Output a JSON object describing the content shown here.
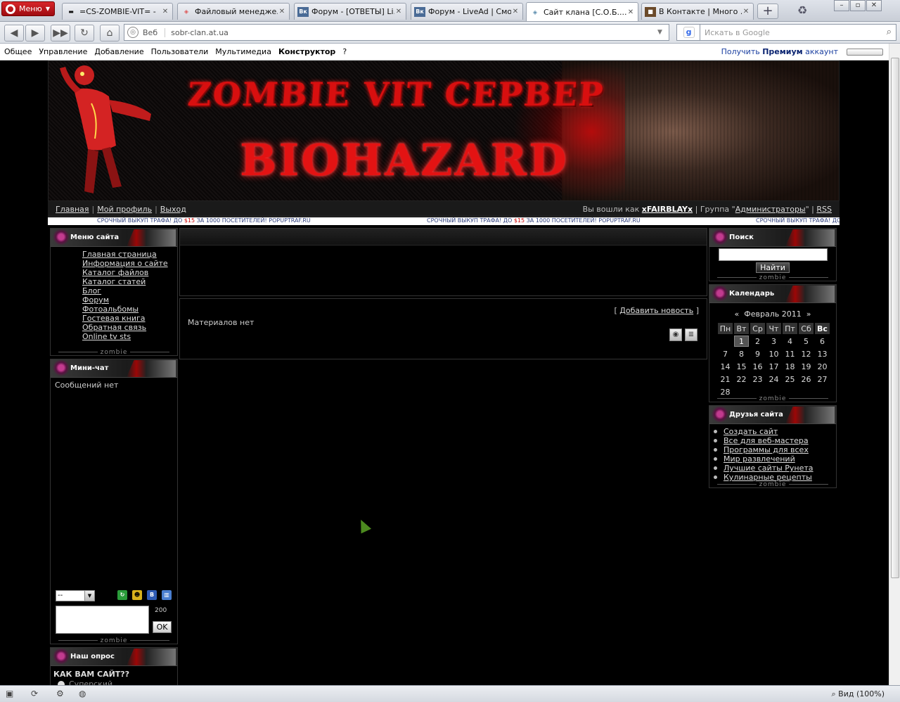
{
  "browser": {
    "menu_label": "Меню",
    "tabs": [
      {
        "title": "=CS-ZOMBIE-VIT= -",
        "icon": "gun-icon"
      },
      {
        "title": "Файловый менедже...",
        "icon": "opera-icon"
      },
      {
        "title": "Форум - [ОТВЕТЫ] Li...",
        "icon": "vk-icon"
      },
      {
        "title": "Форум - LiveAd | Смо...",
        "icon": "vk-icon"
      },
      {
        "title": "Сайт клана [С.О.Б....",
        "icon": "opera-icon",
        "active": true
      },
      {
        "title": "В Контакте | Много ...",
        "icon": "game-icon"
      }
    ],
    "address_label": "Веб",
    "url": "sobr-clan.at.ua",
    "search_placeholder": "Искать в Google",
    "zoom": "Вид (100%)"
  },
  "ucoz_bar": {
    "menu": [
      "Общее",
      "Управление",
      "Добавление",
      "Пользователи",
      "Мультимедиа",
      "Конструктор",
      "?"
    ],
    "premium_pre": "Получить ",
    "premium_bold": "Премиум",
    "premium_post": " аккаунт"
  },
  "banner": {
    "title_top": "ZOMBIE VIT СЕРВЕР",
    "title_bottom": "BIOHAZARD"
  },
  "top_nav": {
    "links": [
      "Главная",
      "Мой профиль",
      "Выход"
    ],
    "logged_in_text": "Вы вошли как",
    "username": "xFAIRBLAYx",
    "group_text": "| Группа \"",
    "group_name": "Администраторы",
    "group_end": "\" |",
    "rss": "RSS"
  },
  "ticker": {
    "pre": "СРОЧНЫЙ ВЫКУП ТРАФА! ДО ",
    "price": "$15",
    "post": " ЗА 1000 ПОСЕТИТЕЛЕЙ!  POPUPTRAF.RU"
  },
  "site_menu": {
    "title": "Меню сайта",
    "items": [
      "Главная страница",
      "Информация о сайте",
      "Каталог файлов",
      "Каталог статей",
      "Блог",
      "Форум",
      "Фотоальбомы",
      "Гостевая книга",
      "Обратная связь",
      "Online tv sts"
    ],
    "footer": "zombie"
  },
  "minichat": {
    "title": "Мини-чат",
    "no_messages": "Сообщений нет",
    "select_value": "--",
    "char_limit": "200",
    "ok": "OK",
    "footer": "zombie"
  },
  "poll": {
    "title": "Наш опрос",
    "question": "КАК ВАМ САЙТ??",
    "option": "Суперский"
  },
  "news": {
    "add_link_open": "[ ",
    "add_link": "Добавить новость",
    "add_link_close": " ]",
    "empty": "Материалов нет"
  },
  "search": {
    "title": "Поиск",
    "button": "Найти",
    "footer": "zombie"
  },
  "calendar": {
    "title": "Календарь",
    "prev": "«",
    "month": "Февраль 2011",
    "next": "»",
    "weekdays": [
      "Пн",
      "Вт",
      "Ср",
      "Чт",
      "Пт",
      "Сб",
      "Вс"
    ],
    "weeks": [
      [
        "",
        "1",
        "2",
        "3",
        "4",
        "5",
        "6"
      ],
      [
        "7",
        "8",
        "9",
        "10",
        "11",
        "12",
        "13"
      ],
      [
        "14",
        "15",
        "16",
        "17",
        "18",
        "19",
        "20"
      ],
      [
        "21",
        "22",
        "23",
        "24",
        "25",
        "26",
        "27"
      ],
      [
        "28",
        "",
        "",
        "",
        "",
        "",
        ""
      ]
    ],
    "today": "1",
    "footer": "zombie"
  },
  "friends": {
    "title": "Друзья сайта",
    "items": [
      "Создать сайт",
      "Все для веб-мастера",
      "Программы для всех",
      "Мир развлечений",
      "Лучшие сайты Рунета",
      "Кулинарные рецепты"
    ],
    "footer": "zombie"
  },
  "colors": {
    "accent_red": "#d80f0f",
    "page_bg": "#000000",
    "ticker_blue": "#2b3c7a"
  }
}
